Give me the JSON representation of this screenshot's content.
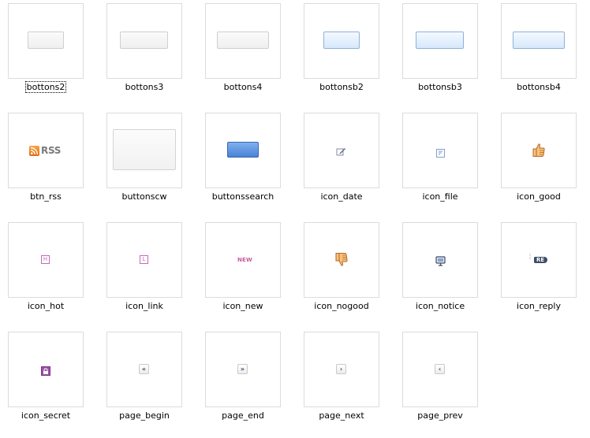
{
  "files": [
    {
      "label": "bottons2",
      "icon": "plain-button-small",
      "selected": true
    },
    {
      "label": "bottons3",
      "icon": "plain-button-medium"
    },
    {
      "label": "bottons4",
      "icon": "plain-button-large"
    },
    {
      "label": "bottonsb2",
      "icon": "blue-button-small"
    },
    {
      "label": "bottonsb3",
      "icon": "blue-button-medium"
    },
    {
      "label": "bottonsb4",
      "icon": "blue-button-large"
    },
    {
      "label": "btn_rss",
      "icon": "rss-icon",
      "text": "RSS"
    },
    {
      "label": "buttonscw",
      "icon": "large-plain-button"
    },
    {
      "label": "buttonssearch",
      "icon": "search-button"
    },
    {
      "label": "icon_date",
      "icon": "pencil-icon"
    },
    {
      "label": "icon_file",
      "icon": "file-icon"
    },
    {
      "label": "icon_good",
      "icon": "thumbs-up-icon"
    },
    {
      "label": "icon_hot",
      "icon": "hot-icon",
      "text": "H"
    },
    {
      "label": "icon_link",
      "icon": "link-icon",
      "text": "L"
    },
    {
      "label": "icon_new",
      "icon": "new-icon",
      "text": "NEW"
    },
    {
      "label": "icon_nogood",
      "icon": "thumbs-down-icon"
    },
    {
      "label": "icon_notice",
      "icon": "monitor-icon"
    },
    {
      "label": "icon_reply",
      "icon": "reply-icon",
      "text": "RE"
    },
    {
      "label": "icon_secret",
      "icon": "lock-icon"
    },
    {
      "label": "page_begin",
      "icon": "double-left-icon",
      "text": "«"
    },
    {
      "label": "page_end",
      "icon": "double-right-icon",
      "text": "»"
    },
    {
      "label": "page_next",
      "icon": "right-icon",
      "text": "›"
    },
    {
      "label": "page_prev",
      "icon": "left-icon",
      "text": "‹"
    }
  ],
  "colors": {
    "thumb_border": "#dcdcdc",
    "hot": "#c86ab8",
    "link": "#c86ab8",
    "file": "#7f9fcf",
    "search_button": "#4a83d6",
    "rss_orange": "#f08c2a"
  }
}
